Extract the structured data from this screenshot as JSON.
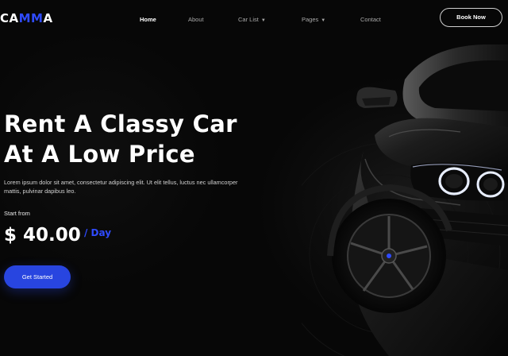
{
  "brand": {
    "prefix": "CA",
    "accent": "MM",
    "suffix": "A",
    "accent_color": "#2f4bff"
  },
  "nav": {
    "items": [
      {
        "label": "Home",
        "active": true
      },
      {
        "label": "About",
        "active": false
      },
      {
        "label": "Car List",
        "active": false,
        "dropdown": true
      },
      {
        "label": "Pages",
        "active": false,
        "dropdown": true
      },
      {
        "label": "Contact",
        "active": false
      }
    ],
    "book_label": "Book Now"
  },
  "hero": {
    "title_line1": "Rent A Classy Car",
    "title_line2": "At A Low Price",
    "description": "Lorem ipsum dolor sit amet, consectetur adipiscing elit. Ut elit tellus, luctus nec ullamcorper mattis, pulvinar dapibus leo.",
    "start_label": "Start from",
    "price": "$ 40.00",
    "per_unit": "/ Day",
    "cta_label": "Get Started"
  },
  "colors": {
    "cta": "#2845e0",
    "background": "#070707"
  },
  "icons": {
    "dropdown": "chevron-down-icon"
  }
}
